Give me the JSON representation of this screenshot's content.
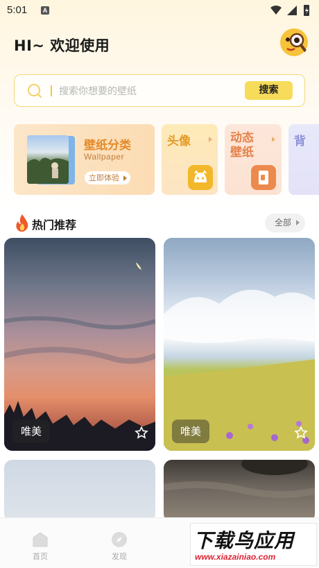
{
  "status_bar": {
    "time": "5:01",
    "notification_badge": "A"
  },
  "header": {
    "greeting": "HI~ 欢迎使用",
    "avatar_icon": "magnifier-emoji-avatar"
  },
  "search": {
    "placeholder": "搜索你想要的壁纸",
    "button_label": "搜索"
  },
  "categories": {
    "wallpaper": {
      "title": "壁纸分类",
      "subtitle": "Wallpaper",
      "cta": "立即体验"
    },
    "avatar": {
      "title": "头像",
      "icon": "avatar-face-icon",
      "color": "#f3b72a"
    },
    "dynamic": {
      "title_line1": "动态",
      "title_line2": "壁纸",
      "icon": "dynamic-wallpaper-icon",
      "color": "#ec8a4e"
    },
    "background": {
      "title": "背"
    }
  },
  "hot_section": {
    "title": "热门推荐",
    "all_label": "全部"
  },
  "tiles": [
    {
      "label": "唯美"
    },
    {
      "label": "唯美"
    },
    {
      "label": ""
    },
    {
      "label": ""
    }
  ],
  "bottom_nav": {
    "items": [
      {
        "label": "首页"
      },
      {
        "label": "发现"
      }
    ]
  },
  "watermark": {
    "title": "下载鸟应用",
    "url": "www.xiazainiao.com"
  },
  "colors": {
    "accent": "#f6dc5a",
    "orange": "#e48a2a"
  }
}
